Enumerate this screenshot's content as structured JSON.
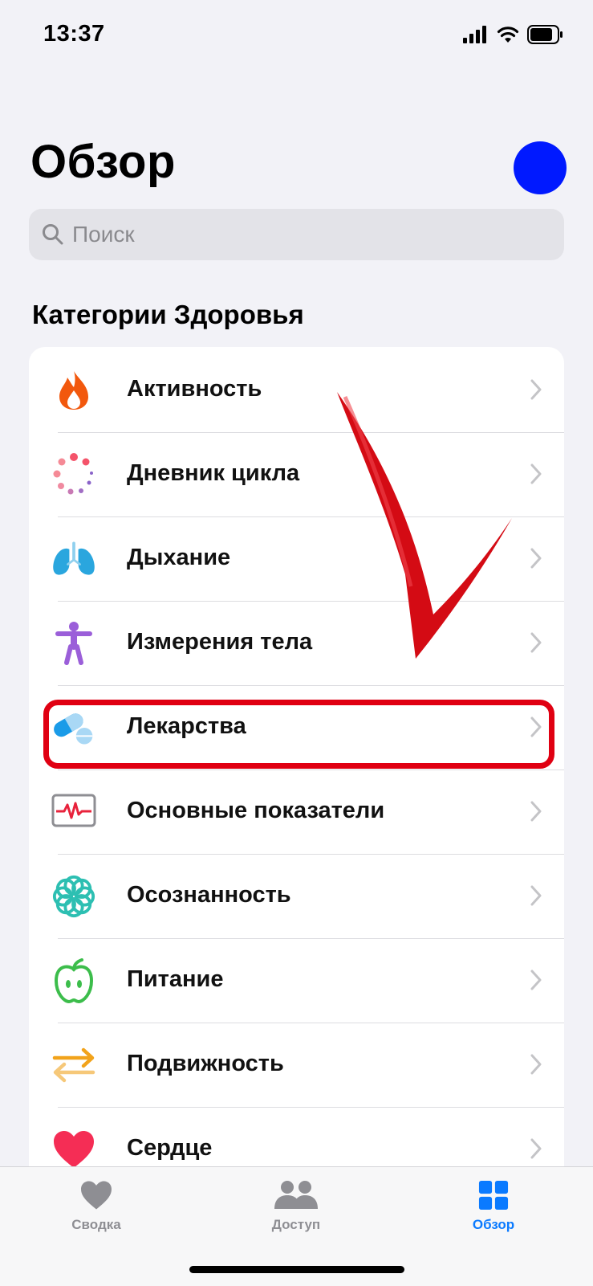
{
  "status_bar": {
    "time": "13:37"
  },
  "header": {
    "title": "Обзор"
  },
  "search": {
    "placeholder": "Поиск"
  },
  "section": {
    "title": "Категории Здоровья"
  },
  "categories": [
    {
      "label": "Активность",
      "icon": "flame-icon"
    },
    {
      "label": "Дневник цикла",
      "icon": "cycle-dots-icon"
    },
    {
      "label": "Дыхание",
      "icon": "lungs-icon"
    },
    {
      "label": "Измерения тела",
      "icon": "person-figure-icon"
    },
    {
      "label": "Лекарства",
      "icon": "pills-icon"
    },
    {
      "label": "Основные показатели",
      "icon": "vitals-monitor-icon"
    },
    {
      "label": "Осознанность",
      "icon": "flower-icon"
    },
    {
      "label": "Питание",
      "icon": "apple-icon"
    },
    {
      "label": "Подвижность",
      "icon": "arrows-icon"
    },
    {
      "label": "Сердце",
      "icon": "heart-icon"
    }
  ],
  "tabs": [
    {
      "label": "Сводка",
      "icon": "heart-icon",
      "active": false
    },
    {
      "label": "Доступ",
      "icon": "people-icon",
      "active": false
    },
    {
      "label": "Обзор",
      "icon": "grid-icon",
      "active": true
    }
  ],
  "colors": {
    "accent": "#0a7aff",
    "highlight": "#e00012",
    "avatar": "#0019ff"
  }
}
